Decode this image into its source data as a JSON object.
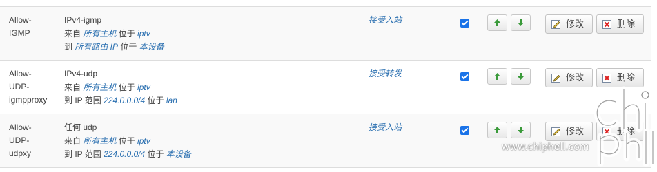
{
  "rules": [
    {
      "name": "Allow-IGMP",
      "action": "接受入站",
      "enabled": true,
      "line1": "IPv4-igmp",
      "line2": {
        "prefix": "来自 ",
        "src": "所有主机",
        "mid": " 位于 ",
        "zone": "iptv"
      },
      "line3": {
        "prefix": "到 ",
        "dest": "所有路由 IP",
        "mid": " 位于 ",
        "zone": "本设备"
      }
    },
    {
      "name": "Allow-UDP-igmpproxy",
      "action": "接受转发",
      "enabled": true,
      "line1": "IPv4-udp",
      "line2": {
        "prefix": "来自 ",
        "src": "所有主机",
        "mid": " 位于 ",
        "zone": "iptv"
      },
      "line3": {
        "prefix": "到 IP 范围 ",
        "dest": "224.0.0.0/4",
        "mid": " 位于 ",
        "zone": "lan"
      }
    },
    {
      "name": "Allow-UDP-udpxy",
      "action": "接受入站",
      "enabled": true,
      "line1": "任何 udp",
      "line2": {
        "prefix": "来自 ",
        "src": "所有主机",
        "mid": " 位于 ",
        "zone": "iptv"
      },
      "line3": {
        "prefix": "到 IP 范围 ",
        "dest": "224.0.0.0/4",
        "mid": " 位于 ",
        "zone": "本设备"
      }
    }
  ],
  "buttons": {
    "edit_label": "修改",
    "delete_label": "删除",
    "move_up_icon": "arrow-up-icon",
    "move_down_icon": "arrow-down-icon"
  },
  "watermark": {
    "url": "www.chiphell.com"
  },
  "colors": {
    "link": "#2a6fb0",
    "checkbox": "#1a73e8",
    "arrow": "#3a9a3a"
  }
}
